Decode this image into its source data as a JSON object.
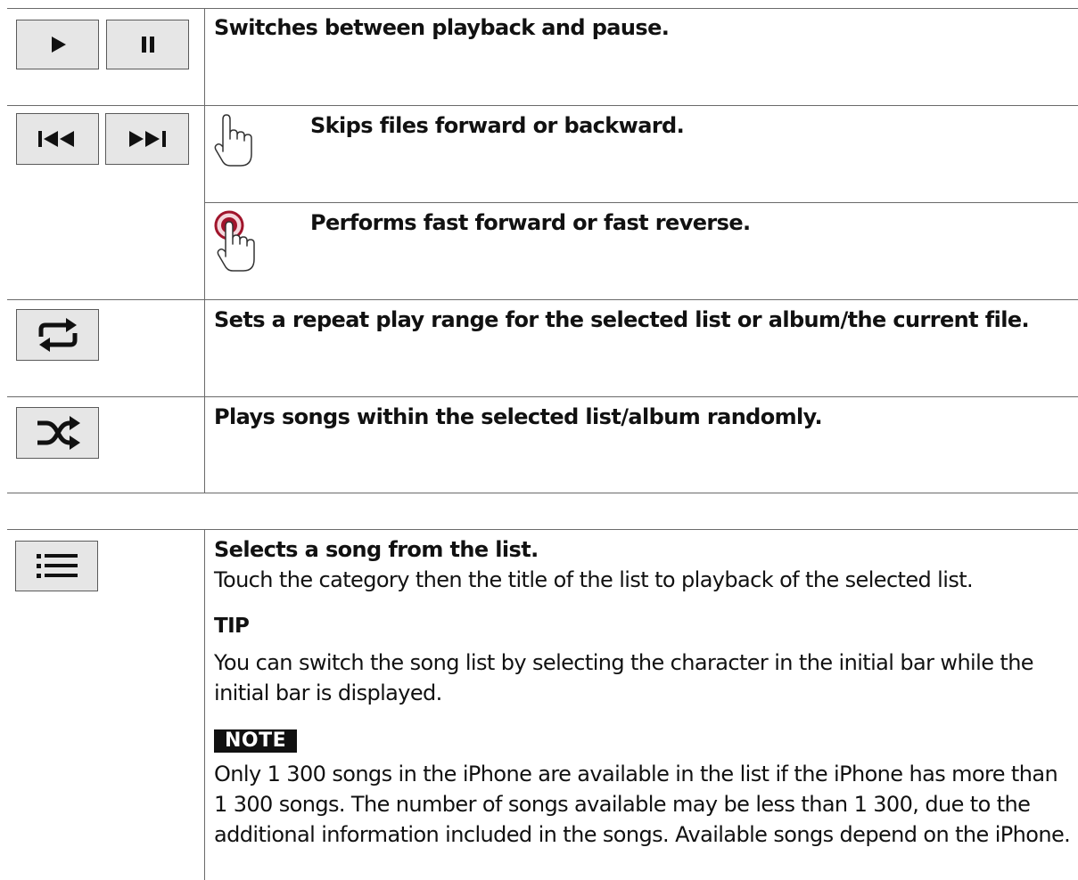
{
  "rows": {
    "play_pause": {
      "icons": [
        "play-icon",
        "pause-icon"
      ],
      "description": "Switches between playback and pause."
    },
    "skip": {
      "icons": [
        "skip-back-icon",
        "skip-forward-icon"
      ],
      "touch_action": {
        "icon": "tap-hand-icon",
        "description": "Skips files forward or backward."
      },
      "hold_action": {
        "icon": "touch-and-hold-hand-icon",
        "description": "Performs fast forward or fast reverse."
      }
    },
    "repeat": {
      "icon": "repeat-icon",
      "description": "Sets a repeat play range for the selected list or album/the current file."
    },
    "shuffle": {
      "icon": "shuffle-icon",
      "description": "Plays songs within the selected list/album randomly."
    }
  },
  "list_section": {
    "icon": "list-icon",
    "title": "Selects a song from the list.",
    "body": "Touch the category then the title of the list to playback of the selected list.",
    "tip_label": "TIP",
    "tip_text": "You can switch the song list by selecting the character in the initial bar while the initial bar is displayed.",
    "note_label": "NOTE",
    "note_text": "Only 1 300 songs in the iPhone are available in the list if the iPhone has more than 1 300 songs. The number of songs available may be less than 1 300, due to the additional information included in the songs. Available songs depend on the iPhone."
  },
  "colors": {
    "button_fill": "#e6e6e6",
    "rule": "#6a6a6a",
    "hold_indicator": "#a0142b"
  }
}
